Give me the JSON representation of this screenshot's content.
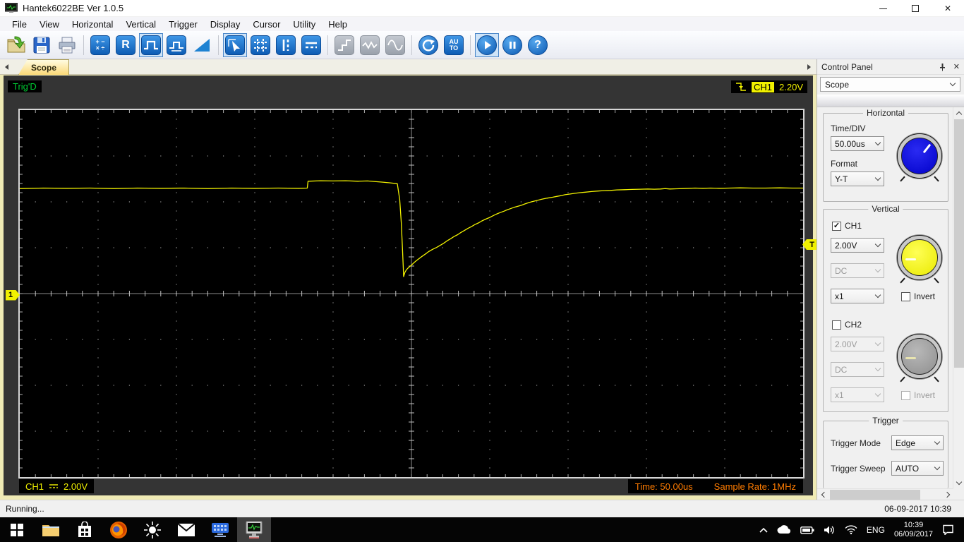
{
  "window": {
    "title": "Hantek6022BE Ver 1.0.5",
    "close_glyph": "✕"
  },
  "menu": {
    "items": [
      "File",
      "View",
      "Horizontal",
      "Vertical",
      "Trigger",
      "Display",
      "Cursor",
      "Utility",
      "Help"
    ]
  },
  "toolbar": {
    "math_line1": "+ −",
    "math_line2": "× ÷",
    "r_label": "R",
    "auto_line1": "AU",
    "auto_line2": "TO",
    "help_label": "?"
  },
  "tabs": {
    "scope": "Scope"
  },
  "scope": {
    "trig_status": "Trig'D",
    "ch1_badge": "CH1",
    "trigger_level": "2.20V",
    "ch1_marker": "1",
    "trigger_marker": "T",
    "ch1_label": "CH1",
    "ch1_scale": "2.00V",
    "time_label": "Time: 50.00us",
    "sample_rate_label": "Sample Rate: 1MHz"
  },
  "control_panel": {
    "title": "Control Panel",
    "selector": "Scope",
    "horizontal": {
      "title": "Horizontal",
      "time_div_label": "Time/DIV",
      "time_div_value": "50.00us",
      "format_label": "Format",
      "format_value": "Y-T"
    },
    "vertical": {
      "title": "Vertical",
      "ch1": {
        "label": "CH1",
        "check": "✓",
        "volt": "2.00V",
        "coupling": "DC",
        "probe": "x1",
        "invert_label": "Invert",
        "invert_check": ""
      },
      "ch2": {
        "label": "CH2",
        "check": "",
        "volt": "2.00V",
        "coupling": "DC",
        "probe": "x1",
        "invert_label": "Invert",
        "invert_check": ""
      }
    },
    "trigger": {
      "title": "Trigger",
      "mode_label": "Trigger Mode",
      "mode_value": "Edge",
      "sweep_label": "Trigger Sweep",
      "sweep_value": "AUTO"
    }
  },
  "statusbar": {
    "left": "Running...",
    "right": "06-09-2017 10:39"
  },
  "taskbar": {
    "tray": {
      "lang": "ENG",
      "time": "10:39",
      "date": "06/09/2017"
    }
  },
  "chart_data": {
    "type": "line",
    "title": "Oscilloscope CH1 trace",
    "time_per_div_us": 50,
    "volts_per_div": 2,
    "h_divisions": 10,
    "v_divisions": 8,
    "x_range_us": [
      -250,
      250
    ],
    "trigger_level_volts": 2.2,
    "ch1_zero_volts": 0,
    "trace_color": "#f2f200",
    "grid_dot_color": "#969696",
    "center_line_color": "#8c8c8c",
    "tick_color": "#c2c2c2",
    "edge_tick_color": "#b0b0b0",
    "points_us_volts": [
      [
        -250,
        4.58
      ],
      [
        -235,
        4.6
      ],
      [
        -220,
        4.59
      ],
      [
        -205,
        4.6
      ],
      [
        -190,
        4.58
      ],
      [
        -175,
        4.6
      ],
      [
        -160,
        4.59
      ],
      [
        -145,
        4.6
      ],
      [
        -130,
        4.58
      ],
      [
        -115,
        4.6
      ],
      [
        -100,
        4.59
      ],
      [
        -85,
        4.6
      ],
      [
        -72,
        4.59
      ],
      [
        -66.5,
        4.6
      ],
      [
        -66,
        4.9
      ],
      [
        -58,
        4.92
      ],
      [
        -50,
        4.91
      ],
      [
        -42,
        4.92
      ],
      [
        -34,
        4.9
      ],
      [
        -28,
        4.91
      ],
      [
        -24,
        4.89
      ],
      [
        -19,
        4.86
      ],
      [
        -14,
        4.83
      ],
      [
        -9,
        4.79
      ],
      [
        -7.5,
        4.1
      ],
      [
        -6.5,
        3.1
      ],
      [
        -5.8,
        2.1
      ],
      [
        -5.2,
        1.1
      ],
      [
        -5,
        0.74
      ],
      [
        -4.2,
        0.92
      ],
      [
        -3.2,
        1.04
      ],
      [
        -1.6,
        1.15
      ],
      [
        0,
        1.24
      ],
      [
        2,
        1.37
      ],
      [
        4,
        1.48
      ],
      [
        6.5,
        1.61
      ],
      [
        9,
        1.73
      ],
      [
        11,
        1.83
      ],
      [
        13.5,
        1.93
      ],
      [
        16,
        2.01
      ],
      [
        18,
        2.09
      ],
      [
        20.5,
        2.19
      ],
      [
        22.5,
        2.29
      ],
      [
        25,
        2.39
      ],
      [
        27,
        2.48
      ],
      [
        29.5,
        2.57
      ],
      [
        31.5,
        2.66
      ],
      [
        34,
        2.76
      ],
      [
        36,
        2.84
      ],
      [
        38.5,
        2.93
      ],
      [
        40.5,
        3.01
      ],
      [
        43,
        3.09
      ],
      [
        45,
        3.17
      ],
      [
        47.5,
        3.25
      ],
      [
        50,
        3.32
      ],
      [
        52,
        3.39
      ],
      [
        54,
        3.46
      ],
      [
        56.5,
        3.53
      ],
      [
        59,
        3.59
      ],
      [
        61,
        3.65
      ],
      [
        63,
        3.7
      ],
      [
        65.5,
        3.76
      ],
      [
        68,
        3.81
      ],
      [
        70.5,
        3.86
      ],
      [
        72.5,
        3.91
      ],
      [
        75,
        3.97
      ],
      [
        77,
        4.01
      ],
      [
        80,
        4.06
      ],
      [
        83,
        4.11
      ],
      [
        86.5,
        4.16
      ],
      [
        90,
        4.2
      ],
      [
        93,
        4.24
      ],
      [
        95.5,
        4.27
      ],
      [
        98,
        4.31
      ],
      [
        101,
        4.34
      ],
      [
        104,
        4.37
      ],
      [
        107.5,
        4.4
      ],
      [
        111,
        4.42
      ],
      [
        115,
        4.45
      ],
      [
        119,
        4.47
      ],
      [
        123,
        4.49
      ],
      [
        127,
        4.5
      ],
      [
        131,
        4.52
      ],
      [
        136,
        4.53
      ],
      [
        141,
        4.54
      ],
      [
        146,
        4.55
      ],
      [
        151,
        4.56
      ],
      [
        155,
        4.55
      ],
      [
        159,
        4.56
      ],
      [
        162,
        4.58
      ],
      [
        165,
        4.56
      ],
      [
        169,
        4.57
      ],
      [
        173,
        4.58
      ],
      [
        177,
        4.59
      ],
      [
        181,
        4.6
      ],
      [
        186,
        4.59
      ],
      [
        191,
        4.6
      ],
      [
        197,
        4.59
      ],
      [
        203,
        4.6
      ],
      [
        210,
        4.61
      ],
      [
        218,
        4.6
      ],
      [
        226,
        4.6
      ],
      [
        235,
        4.61
      ],
      [
        243,
        4.6
      ],
      [
        250,
        4.6
      ]
    ]
  }
}
